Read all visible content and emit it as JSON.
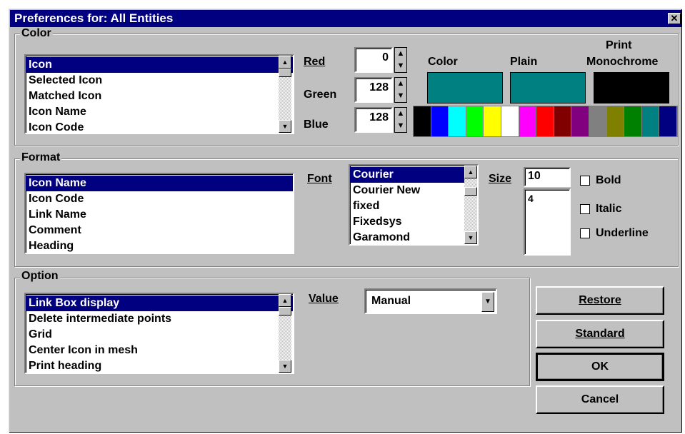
{
  "window": {
    "title": "Preferences for: All Entities",
    "close_label": "✕"
  },
  "color_group": {
    "label": "Color",
    "list": [
      "Icon",
      "Selected Icon",
      "Matched Icon",
      "Icon Name",
      "Icon Code"
    ],
    "selected_index": 0,
    "red_label": "Red",
    "red_value": "0",
    "green_label": "Green",
    "green_value": "128",
    "blue_label": "Blue",
    "blue_value": "128",
    "color_header": "Color",
    "plain_header": "Plain",
    "print_header": "Print",
    "mono_header": "Monochrome",
    "color_swatch": "#008080",
    "plain_swatch": "#008080",
    "mono_swatch": "#000000",
    "palette": [
      "#000000",
      "#0000ff",
      "#00ffff",
      "#00ff00",
      "#ffff00",
      "#ffffff",
      "#ff00ff",
      "#ff0000",
      "#800000",
      "#800080",
      "#808080",
      "#808000",
      "#008000",
      "#008080",
      "#000080"
    ]
  },
  "format_group": {
    "label": "Format",
    "list": [
      "Icon Name",
      "Icon Code",
      "Link Name",
      "Comment",
      "Heading"
    ],
    "selected_index": 0,
    "font_label": "Font",
    "fonts": [
      "Courier",
      "Courier New",
      "fixed",
      "Fixedsys",
      "Garamond"
    ],
    "size_label": "Size",
    "size_value": "10",
    "size_list": [
      "4"
    ],
    "bold_label": "Bold",
    "italic_label": "Italic",
    "underline_label": "Underline"
  },
  "option_group": {
    "label": "Option",
    "list": [
      "Link Box display",
      "Delete intermediate points",
      "Grid",
      "Center Icon in mesh",
      "Print heading"
    ],
    "selected_index": 0,
    "value_label": "Value",
    "value_selected": "Manual"
  },
  "buttons": {
    "restore": "Restore",
    "standard": "Standard",
    "ok": "OK",
    "cancel": "Cancel"
  }
}
